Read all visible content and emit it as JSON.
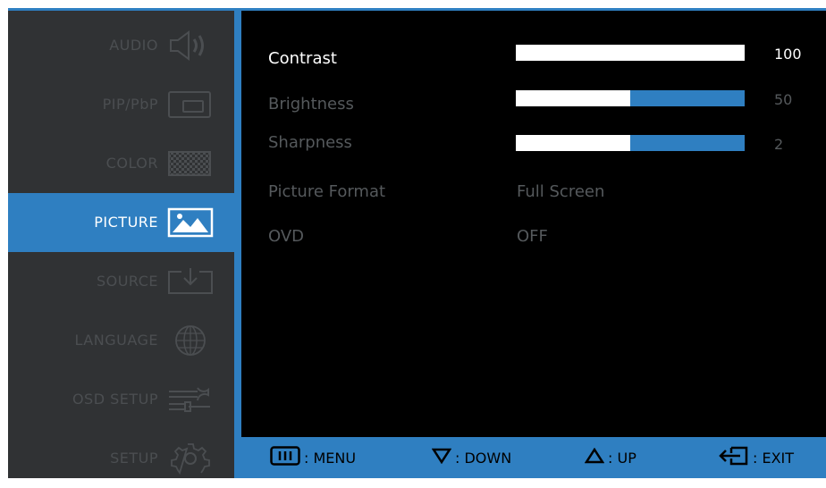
{
  "sidebar": {
    "items": [
      {
        "label": "AUDIO",
        "icon": "speaker-icon",
        "active": false
      },
      {
        "label": "PIP/PbP",
        "icon": "pip-icon",
        "active": false
      },
      {
        "label": "COLOR",
        "icon": "color-grid-icon",
        "active": false
      },
      {
        "label": "PICTURE",
        "icon": "picture-icon",
        "active": true
      },
      {
        "label": "SOURCE",
        "icon": "source-input-icon",
        "active": false
      },
      {
        "label": "LANGUAGE",
        "icon": "globe-icon",
        "active": false
      },
      {
        "label": "OSD SETUP",
        "icon": "osd-setup-icon",
        "active": false
      },
      {
        "label": "SETUP",
        "icon": "gear-icon",
        "active": false
      }
    ]
  },
  "picture": {
    "contrast": {
      "label": "Contrast",
      "value": "100",
      "level": 1.0
    },
    "brightness": {
      "label": "Brightness",
      "value": "50",
      "level": 0.5
    },
    "sharpness": {
      "label": "Sharpness",
      "value": "2",
      "level": 0.5
    },
    "format": {
      "label": "Picture Format",
      "value": "Full Screen"
    },
    "ovd": {
      "label": "OVD",
      "value": "OFF"
    }
  },
  "footer": {
    "menu": ": MENU",
    "down": ": DOWN",
    "up": ": UP",
    "exit": ": EXIT"
  },
  "colors": {
    "accent": "#2f7fc1",
    "sidebar_bg": "#303234",
    "inactive_text": "#55595c"
  }
}
